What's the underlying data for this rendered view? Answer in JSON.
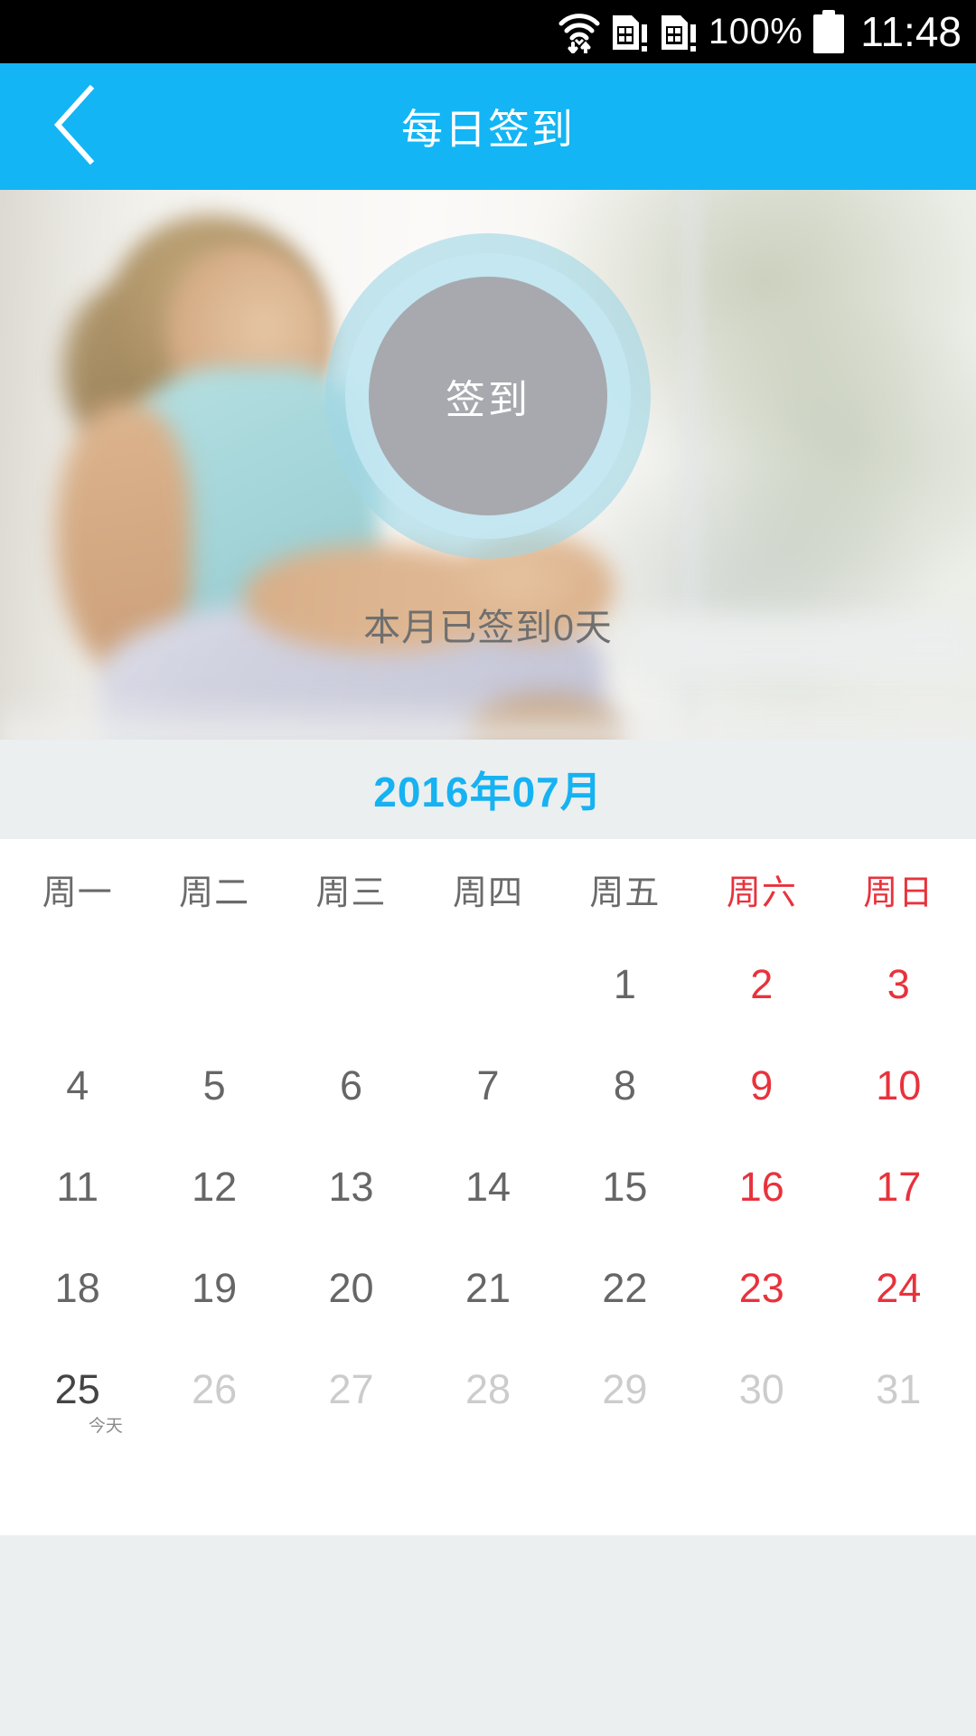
{
  "statusbar": {
    "wifi_icon": "wifi-data-transfer-icon",
    "sim1_icon": "sim-card-alert-icon",
    "sim2_icon": "sim-card-alert-icon",
    "battery_percent": "100%",
    "battery_icon": "battery-full-icon",
    "time": "11:48"
  },
  "header": {
    "back_icon": "chevron-left-icon",
    "title": "每日签到"
  },
  "hero": {
    "checkin_button_label": "签到",
    "month_count_text": "本月已签到0天",
    "ring_outer_color": "#a0d6e5",
    "ring_inner_color": "#c4e8f2",
    "button_color": "#a7a9ae"
  },
  "calendar": {
    "month_label": "2016年07月",
    "month_label_color": "#16b2f2",
    "weekday_headers": [
      {
        "label": "周一",
        "weekend": false
      },
      {
        "label": "周二",
        "weekend": false
      },
      {
        "label": "周三",
        "weekend": false
      },
      {
        "label": "周四",
        "weekend": false
      },
      {
        "label": "周五",
        "weekend": false
      },
      {
        "label": "周六",
        "weekend": true
      },
      {
        "label": "周日",
        "weekend": true
      }
    ],
    "today_tag": "今天",
    "colors": {
      "past_weekday": "#666666",
      "past_weekend": "#e8323c",
      "today": "#444444",
      "future": "#cccccc"
    },
    "weeks": [
      [
        {
          "day": "",
          "state": "empty"
        },
        {
          "day": "",
          "state": "empty"
        },
        {
          "day": "",
          "state": "empty"
        },
        {
          "day": "",
          "state": "empty"
        },
        {
          "day": "1",
          "state": "past"
        },
        {
          "day": "2",
          "state": "past-weekend"
        },
        {
          "day": "3",
          "state": "past-weekend"
        }
      ],
      [
        {
          "day": "4",
          "state": "past"
        },
        {
          "day": "5",
          "state": "past"
        },
        {
          "day": "6",
          "state": "past"
        },
        {
          "day": "7",
          "state": "past"
        },
        {
          "day": "8",
          "state": "past"
        },
        {
          "day": "9",
          "state": "past-weekend"
        },
        {
          "day": "10",
          "state": "past-weekend"
        }
      ],
      [
        {
          "day": "11",
          "state": "past"
        },
        {
          "day": "12",
          "state": "past"
        },
        {
          "day": "13",
          "state": "past"
        },
        {
          "day": "14",
          "state": "past"
        },
        {
          "day": "15",
          "state": "past"
        },
        {
          "day": "16",
          "state": "past-weekend"
        },
        {
          "day": "17",
          "state": "past-weekend"
        }
      ],
      [
        {
          "day": "18",
          "state": "past"
        },
        {
          "day": "19",
          "state": "past"
        },
        {
          "day": "20",
          "state": "past"
        },
        {
          "day": "21",
          "state": "past"
        },
        {
          "day": "22",
          "state": "past"
        },
        {
          "day": "23",
          "state": "past-weekend"
        },
        {
          "day": "24",
          "state": "past-weekend"
        }
      ],
      [
        {
          "day": "25",
          "state": "today"
        },
        {
          "day": "26",
          "state": "future"
        },
        {
          "day": "27",
          "state": "future"
        },
        {
          "day": "28",
          "state": "future"
        },
        {
          "day": "29",
          "state": "future"
        },
        {
          "day": "30",
          "state": "future"
        },
        {
          "day": "31",
          "state": "future"
        }
      ]
    ]
  }
}
